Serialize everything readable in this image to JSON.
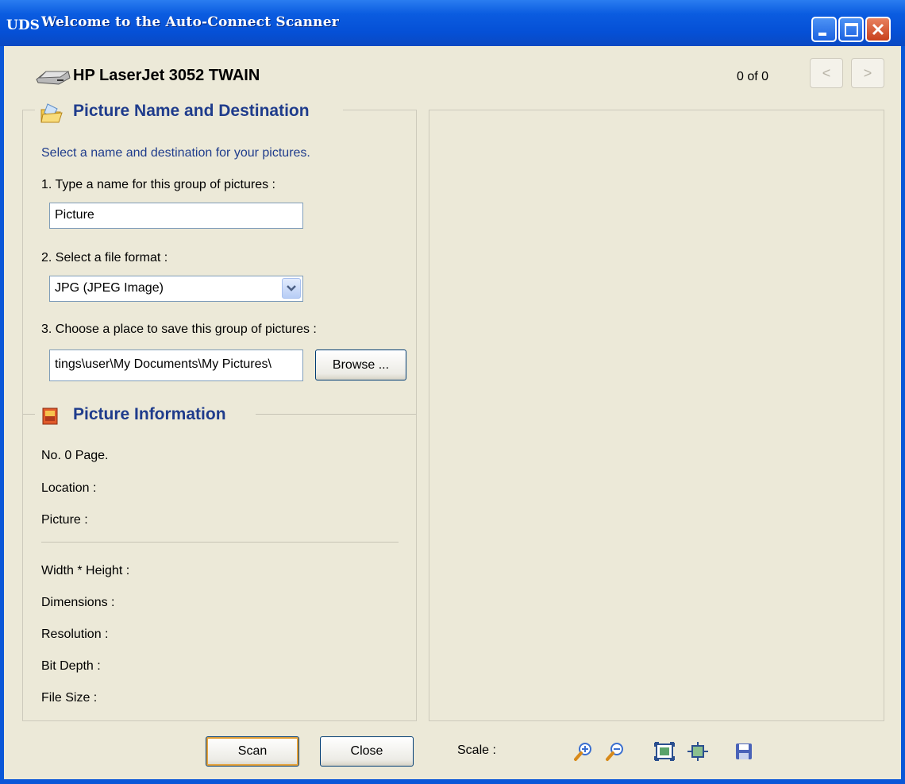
{
  "window": {
    "badge": "UDS",
    "title": "Welcome to the Auto-Connect Scanner"
  },
  "header": {
    "device": "HP LaserJet 3052 TWAIN",
    "counter": "0  of  0",
    "prev_label": "<",
    "next_label": ">"
  },
  "destination": {
    "title": "Picture Name and Destination",
    "instructions": "Select a name and destination for your pictures.",
    "step1_label": "1. Type a name for this group of pictures :",
    "name_value": "Picture",
    "step2_label": "2. Select a file format :",
    "format_value": "JPG (JPEG Image)",
    "step3_label": "3. Choose a place to save this group of pictures :",
    "path_value": "tings\\user\\My Documents\\My Pictures\\",
    "browse_label": "Browse ..."
  },
  "info": {
    "title": "Picture Information",
    "page": "No. 0 Page.",
    "location": "Location :",
    "picture": "Picture :",
    "width_height": "Width * Height :",
    "dimensions": "Dimensions :",
    "resolution": "Resolution :",
    "bit_depth": "Bit Depth :",
    "file_size": "File Size :"
  },
  "footer": {
    "scan_label": "Scan",
    "close_label": "Close",
    "scale_label": "Scale :",
    "tools": [
      "zoom-in-icon",
      "zoom-out-icon",
      "fit-image-icon",
      "actual-size-icon",
      "save-icon"
    ]
  },
  "colors": {
    "titlebar": "#0550d6",
    "client": "#ece9d8",
    "heading": "#1f3c8c"
  }
}
